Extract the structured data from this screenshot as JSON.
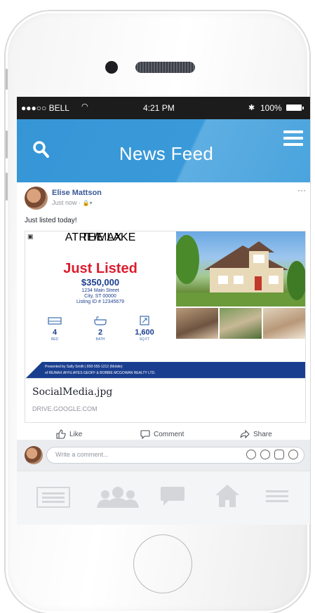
{
  "status_bar": {
    "carrier": "●●●○○ BELL",
    "time": "4:21 PM",
    "battery": "100%"
  },
  "header": {
    "title": "News Feed"
  },
  "post": {
    "author": "Elise Mattson",
    "meta": "Just now · ",
    "text": "Just listed today!",
    "more": "···",
    "ad": {
      "brand": "RE/MAX",
      "brand_sub": "AT THE LAKE",
      "headline": "Just Listed",
      "price": "$350,000",
      "address_line1": "1234 Main Street",
      "address_line2": "City, ST 00000",
      "listing_id": "Listing ID # 12345679",
      "stats": [
        {
          "value": "4",
          "label": "BED"
        },
        {
          "value": "2",
          "label": "BATH"
        },
        {
          "value": "1,600",
          "label": "SQ FT"
        }
      ],
      "band_line1": "Presented by Sally Smith | 800-555-1212 (Mobile)",
      "band_line2": "of RE/MAX AFFILIATES GEOFF & BOBBIE MCGOWAN REALTY LTD."
    },
    "link_title": "SocialMedia.jpg",
    "link_url": "DRIVE.GOOGLE.COM",
    "actions": {
      "like": "Like",
      "comment": "Comment",
      "share": "Share"
    }
  },
  "comment": {
    "placeholder": "Write a comment..."
  },
  "colors": {
    "header_blue": "#3b9ad9",
    "facebook_blue": "#3b5998",
    "remax_red": "#dc1c2e",
    "remax_blue": "#1a3e8f"
  }
}
